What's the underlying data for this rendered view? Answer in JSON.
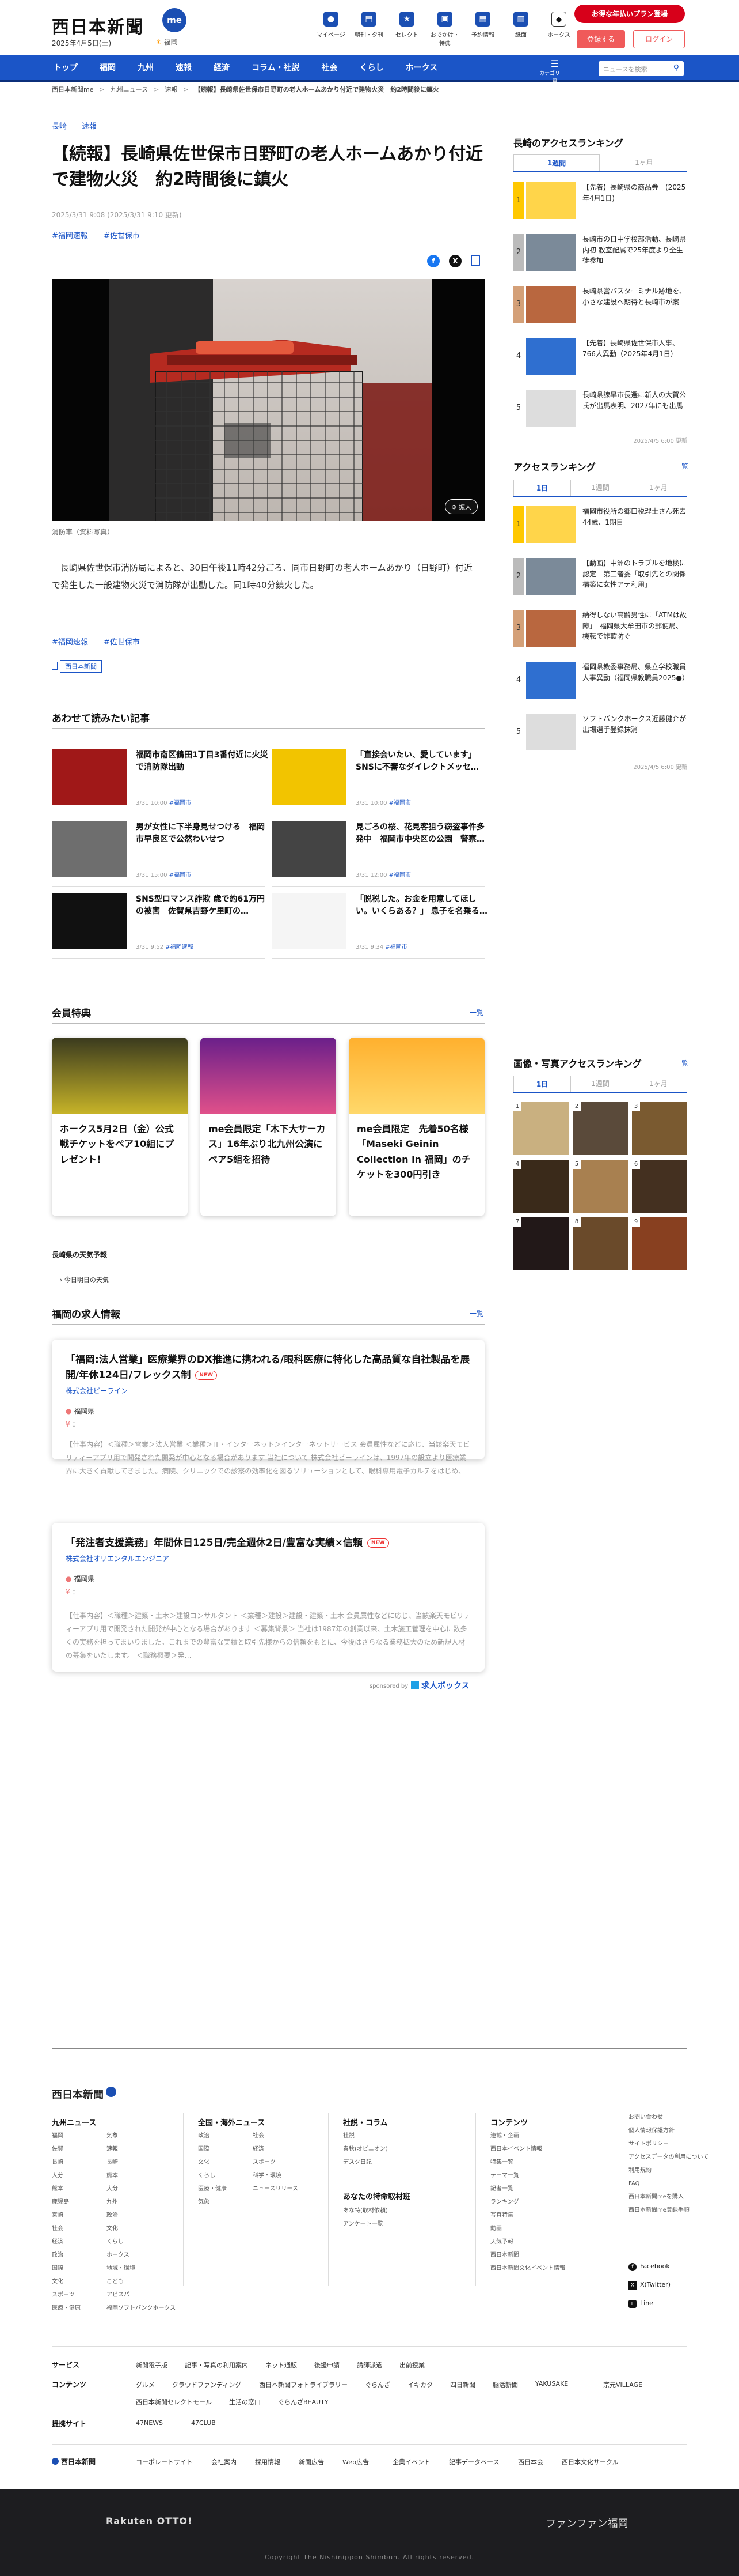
{
  "header": {
    "logo": "西日本新聞",
    "logo_badge": "me",
    "date": "2025年4月5日(土)",
    "weather": "福岡",
    "icons": [
      {
        "label": "マイページ",
        "icon": "person-icon"
      },
      {
        "label": "朝刊・夕刊",
        "icon": "newspaper-icon"
      },
      {
        "label": "セレクト",
        "icon": "star-icon"
      },
      {
        "label": "おでかけ・特典",
        "icon": "gift-icon"
      },
      {
        "label": "予約情報",
        "icon": "calendar-icon"
      },
      {
        "label": "紙面",
        "icon": "paper-icon"
      },
      {
        "label": "ホークス",
        "icon": "hawks-icon"
      }
    ],
    "subscribe": "お得な年払いプラン登場",
    "register": "登録する",
    "login": "ログイン"
  },
  "nav": {
    "items": [
      "トップ",
      "福岡",
      "九州",
      "速報",
      "経済",
      "コラム・社説",
      "社会",
      "くらし",
      "ホークス"
    ],
    "menu_label": "カテゴリー一覧",
    "search_placeholder": "ニュースを検索"
  },
  "breadcrumb": [
    "西日本新聞me",
    "九州ニュース",
    "速報",
    "【続報】長崎県佐世保市日野町の老人ホームあかり付近で建物火災　約2時間後に鎮火"
  ],
  "article": {
    "categories": [
      "長崎",
      "速報"
    ],
    "title": "【続報】長崎県佐世保市日野町の老人ホームあかり付近で建物火災　約2時間後に鎮火",
    "datetime": "2025/3/31 9:08 (2025/3/31 9:10 更新)",
    "tags": [
      "#福岡速報",
      "#佐世保市"
    ],
    "photo_badge": "拡大",
    "caption": "消防車（資料写真）",
    "body": "長崎県佐世保市消防局によると、30日午後11時42分ごろ、同市日野町の老人ホームあかり（日野町）付近で発生した一般建物火災で消防隊が出動した。同1時40分鎮火した。",
    "bottom_tags": [
      "#福岡速報",
      "#佐世保市"
    ],
    "source_badge": "西日本新聞"
  },
  "related": {
    "heading": "あわせて読みたい記事",
    "items": [
      {
        "title": "福岡市南区鶴田1丁目3番付近に火災で消防隊出動",
        "date": "3/31 10:00",
        "tag": "#福岡市"
      },
      {
        "title": "「直接会いたい、愛しています」 SNSに不審なダイレクトメッセ…",
        "date": "3/31 10:00",
        "tag": "#福岡市"
      },
      {
        "title": "男が女性に下半身見せつける　福岡市早良区で公然わいせつ",
        "date": "3/31 15:00",
        "tag": "#福岡市"
      },
      {
        "title": "見ごろの桜、花見客狙う窃盗事件多発中　福岡市中央区の公園　警察…",
        "date": "3/31 12:00",
        "tag": "#福岡市"
      },
      {
        "title": "SNS型ロマンス詐欺 歳で約61万円の被害　佐賀県吉野ケ里町の…",
        "date": "3/31 9:52",
        "tag": "#福岡速報"
      },
      {
        "title": "「脱税した。お金を用意してほしい。いくらある？」 息子を名乗る…",
        "date": "3/31 9:34",
        "tag": "#福岡市"
      }
    ]
  },
  "perks": {
    "heading": "会員特典",
    "more": "一覧",
    "items": [
      "ホークス5月2日（金）公式戦チケットをペア10組にプレゼント！",
      "me会員限定「木下大サーカス」16年ぶり北九州公演にペア5組を招待",
      "me会員限定　先着50名様「Maseki Geinin Collection in 福岡」のチケットを300円引き"
    ]
  },
  "weather_section": {
    "heading": "長崎県の天気予報",
    "link": "今日明日の天気"
  },
  "jobs": {
    "heading": "福岡の求人情報",
    "more": "一覧",
    "items": [
      {
        "title": "「福岡:法人営業」医療業界のDX推進に携われる/眼科医療に特化した高品質な自社製品を展開/年休124日/フレックス制",
        "badge": "NEW",
        "company": "株式会社ビーライン",
        "location": "福岡県",
        "salary": "：",
        "desc": "【仕事内容】＜職種＞営業＞法人営業 ＜業種＞IT・インターネット＞インターネットサービス 会員属性などに応じ、当該楽天モビリティーアプリ用で開発された開発が中心となる場合があります 当社について 株式会社ビーラインは、1997年の設立より医療業界に大きく貢献してきました。病院、クリニックでの診察の効率化を図るソリューションとして、眼科専用電子カルテをはじめ、画像検査ファイリングシステムなど、医…"
      },
      {
        "title": "「発注者支援業務」年間休日125日/完全週休2日/豊富な実績×信頼",
        "badge": "NEW",
        "company": "株式会社オリエンタルエンジニア",
        "location": "福岡県",
        "salary": "：",
        "desc": "【仕事内容】＜職種＞建築・土木＞建設コンサルタント ＜業種＞建設＞建設・建築・土木 会員属性などに応じ、当該楽天モビリティーアプリ用で開発された開発が中心となる場合があります ＜募集背景＞ 当社は1987年の創業以来、土木施工管理を中心に数多くの実務を担ってまいりました。これまでの豊富な実績と取引先様からの信頼をもとに、今後はさらなる業務拡大のため新規人材の募集をいたします。 ＜職務概要＞発…"
      }
    ],
    "sponsor_label": "sponsored by",
    "sponsor": "求人ボックス"
  },
  "sidebar": {
    "ranking_nagasaki": {
      "heading": "長崎のアクセスランキング",
      "tabs": [
        "1週間",
        "1ヶ月"
      ],
      "items": [
        "【先着】長崎県の商品券　(2025年4月1日)",
        "長崎市の日中学校部活動、長崎県内初 教室配属で25年度より全生徒参加",
        "長崎県営バスターミナル跡地を、小さな建設へ期待と長崎市が案",
        "【先着】長崎県佐世保市人事、766人異動（2025年4月1日）",
        "長崎県諫早市長選に新人の大賀公氏が出馬表明、2027年にも出馬"
      ],
      "updated": "2025/4/5 6:00 更新"
    },
    "ranking_access": {
      "heading": "アクセスランキング",
      "more": "一覧",
      "tabs": [
        "1日",
        "1週間",
        "1ヶ月"
      ],
      "items": [
        "福岡市役所の郷口税理士さん死去 44歳、1期目",
        "【動画】中洲のトラブルを地検に認定　第三者委「取引先との関係構築に女性アテ利用」",
        "納得しない高齢男性に「ATMは故障」　福岡県大牟田市の郵便局、機転で詐欺防ぐ",
        "福岡県教委事務局、県立学校職員人事異動（福岡県教職員2025●）",
        "ソフトバンクホークス近藤健介が出場選手登録抹消"
      ],
      "updated": "2025/4/5 6:00 更新"
    },
    "photo_ranking": {
      "heading": "画像・写真アクセスランキング",
      "more": "一覧",
      "tabs": [
        "1日",
        "1週間",
        "1ヶ月"
      ],
      "numbers": [
        "1",
        "2",
        "3",
        "4",
        "5",
        "6",
        "7",
        "8",
        "9"
      ]
    }
  },
  "footer": {
    "logo": "西日本新聞",
    "cols": [
      {
        "heading": "九州ニュース",
        "links": [
          "福岡",
          "佐賀",
          "長崎",
          "大分",
          "熊本",
          "鹿児島",
          "宮崎",
          "社会",
          "経済",
          "政治",
          "国際",
          "文化",
          "スポーツ",
          "医療・健康",
          "気象",
          "速報",
          "長崎",
          "熊本",
          "大分",
          "九州",
          "政治",
          "文化",
          "くらし",
          "ホークス",
          "地域・環境",
          "こども",
          "アビスパ",
          "福岡ソフトバンクホークス"
        ]
      },
      {
        "heading": "全国・海外ニュース",
        "links": [
          "政治",
          "国際",
          "文化",
          "くらし",
          "医療・健康",
          "気象",
          "社会",
          "経済",
          "スポーツ",
          "科学・環境",
          "ニュースリリース"
        ]
      },
      {
        "heading": "社説・コラム",
        "links": [
          "社説",
          "春秋(オピニオン)",
          "デスク日記"
        ]
      },
      {
        "heading": "コンテンツ",
        "links": [
          "連載・企画",
          "西日本イベント情報",
          "特集一覧",
          "テーマ一覧",
          "記者一覧",
          "ランキング",
          "写真特集",
          "動画",
          "天気予報",
          "西日本新聞",
          "西日本新聞文化イベント情報"
        ]
      },
      {
        "heading": "",
        "links": [
          "お問い合わせ",
          "個人情報保護方針",
          "サイトポリシー",
          "アクセスデータの利用について",
          "利用規約",
          "FAQ",
          "西日本新聞meを購入",
          "西日本新聞me登録手順"
        ]
      }
    ],
    "special_heading": "あなたの特命取材班",
    "special_links": [
      "あな特(取材依頼)",
      "アンケート一覧"
    ],
    "social": [
      "Facebook",
      "X(Twitter)",
      "Line"
    ],
    "rows": [
      {
        "heading": "サービス",
        "links": [
          "新聞電子版",
          "記事・写真の利用案内",
          "ネット通販",
          "後援申請",
          "講師派遣",
          "出前授業"
        ]
      },
      {
        "heading": "コンテンツ",
        "links": [
          "グルメ",
          "クラウドファンディング",
          "西日本新聞フォトライブラリー",
          "ぐらんざ",
          "イキカタ",
          "四日新聞",
          "脳活新聞",
          "YAKUSAKE",
          "宗元VILLAGE",
          "西日本新聞セレクトモール",
          "生活の窓口",
          "ぐらんざBEAUTY"
        ]
      },
      {
        "heading": "提携サイト",
        "links": [
          "47NEWS",
          "47CLUB"
        ]
      }
    ],
    "corp_links": [
      "コーポレートサイト",
      "会社案内",
      "採用情報",
      "新聞広告",
      "Web広告",
      "企業イベント",
      "記事データベース",
      "西日本会",
      "西日本文化サークル"
    ],
    "bottom_left": "Rakuten OTTO!",
    "bottom_right": "ファンファン福岡",
    "copyright": "Copyright The Nishinippon Shimbun. All rights reserved."
  },
  "colors": {
    "brand_blue": "#1b55c7",
    "accent_red": "#d7001a"
  }
}
